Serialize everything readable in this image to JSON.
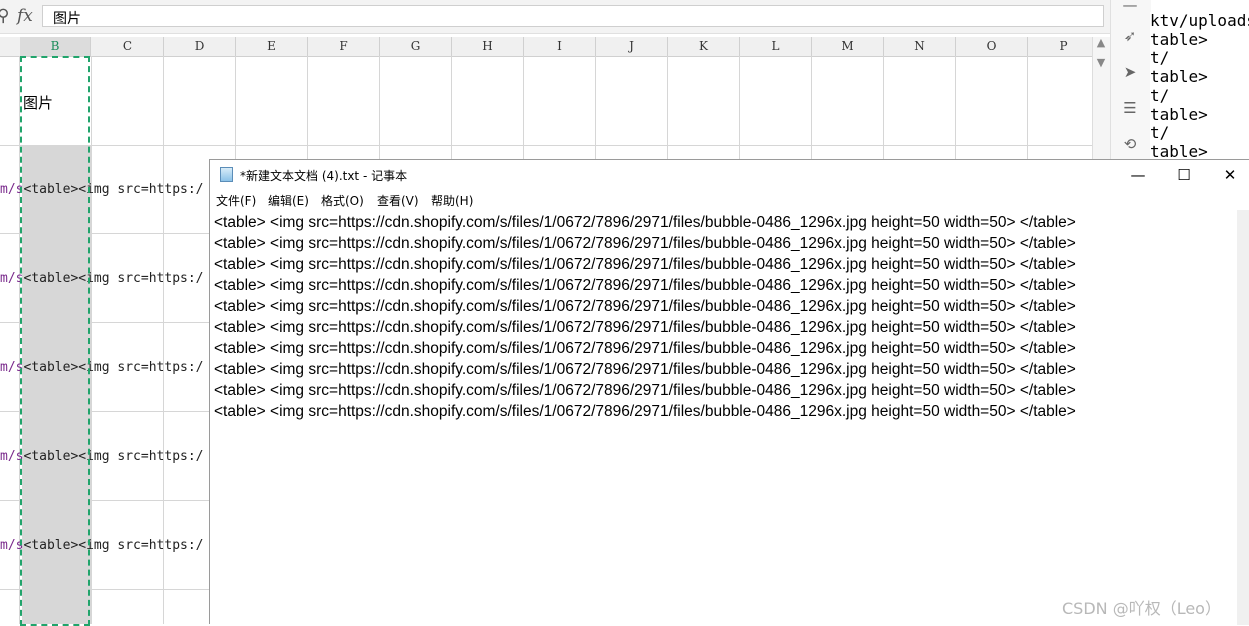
{
  "formula_bar": {
    "fx": "fx",
    "value": "图片"
  },
  "columns": [
    "B",
    "C",
    "D",
    "E",
    "F",
    "G",
    "H",
    "I",
    "J",
    "K",
    "L",
    "M",
    "N",
    "O",
    "P"
  ],
  "selected_column": "B",
  "cell_b1": "图片",
  "row_cells": [
    {
      "prefix": "m/s",
      "text": "<table><img src=https:/"
    },
    {
      "prefix": "m/s",
      "text": "<table><img src=https:/"
    },
    {
      "prefix": "m/s",
      "text": "<table><img src=https:/"
    },
    {
      "prefix": "m/s",
      "text": "<table><img src=https:/"
    },
    {
      "prefix": "m/s",
      "text": "<table><img src=https:/"
    }
  ],
  "background_code": "ktv/uploads\ntable>\nt/\ntable>\nt/\ntable>\nt/\ntable>",
  "notepad": {
    "title": "*新建文本文档 (4).txt - 记事本",
    "menu": [
      "文件(F)",
      "编辑(E)",
      "格式(O)",
      "查看(V)",
      "帮助(H)"
    ],
    "lines": [
      "<table> <img src=https://cdn.shopify.com/s/files/1/0672/7896/2971/files/bubble-0486_1296x.jpg height=50 width=50> </table>",
      "<table> <img src=https://cdn.shopify.com/s/files/1/0672/7896/2971/files/bubble-0486_1296x.jpg height=50 width=50> </table>",
      "<table> <img src=https://cdn.shopify.com/s/files/1/0672/7896/2971/files/bubble-0486_1296x.jpg height=50 width=50> </table>",
      "<table> <img src=https://cdn.shopify.com/s/files/1/0672/7896/2971/files/bubble-0486_1296x.jpg height=50 width=50> </table>",
      "<table> <img src=https://cdn.shopify.com/s/files/1/0672/7896/2971/files/bubble-0486_1296x.jpg height=50 width=50> </table>",
      "<table> <img src=https://cdn.shopify.com/s/files/1/0672/7896/2971/files/bubble-0486_1296x.jpg height=50 width=50> </table>",
      "<table> <img src=https://cdn.shopify.com/s/files/1/0672/7896/2971/files/bubble-0486_1296x.jpg height=50 width=50> </table>",
      "<table> <img src=https://cdn.shopify.com/s/files/1/0672/7896/2971/files/bubble-0486_1296x.jpg height=50 width=50> </table>",
      "<table> <img src=https://cdn.shopify.com/s/files/1/0672/7896/2971/files/bubble-0486_1296x.jpg height=50 width=50> </table>",
      "<table> <img src=https://cdn.shopify.com/s/files/1/0672/7896/2971/files/bubble-0486_1296x.jpg height=50 width=50> </table>"
    ],
    "window_buttons": {
      "minimize": "—",
      "maximize": "☐",
      "close": "✕"
    }
  },
  "watermark": "CSDN @吖权（Leo）",
  "colors": {
    "selection_border": "#20a46b",
    "selected_column_fill": "#d7d7d7"
  }
}
